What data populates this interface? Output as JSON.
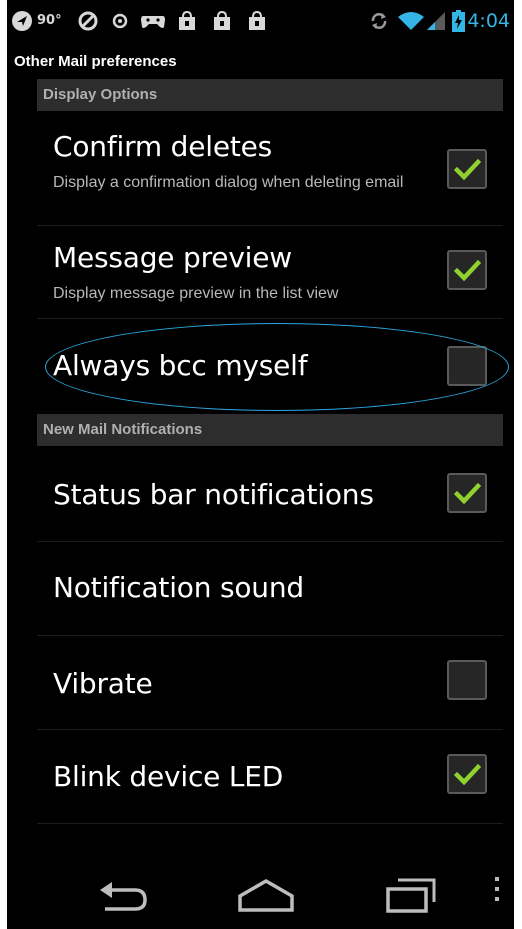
{
  "status_bar": {
    "temperature": "90°",
    "time": "4:04",
    "icons": [
      "nav-arrow-icon",
      "blocked-icon",
      "circle-dot-icon",
      "game-controller-icon",
      "shopping-bag-icon",
      "shopping-bag-icon",
      "shopping-bag-icon",
      "sync-icon",
      "wifi-icon",
      "cell-signal-icon",
      "battery-icon"
    ],
    "accent_color": "#33b5e5"
  },
  "app": {
    "title": "Other Mail preferences"
  },
  "sections": [
    {
      "header": "Display Options",
      "items": [
        {
          "title": "Confirm deletes",
          "summary": "Display a confirmation dialog when deleting email",
          "has_checkbox": true,
          "checked": true
        },
        {
          "title": "Message preview",
          "summary": "Display message preview in the list view",
          "has_checkbox": true,
          "checked": true
        },
        {
          "title": "Always bcc myself",
          "summary": "",
          "has_checkbox": true,
          "checked": false
        }
      ]
    },
    {
      "header": "New Mail Notifications",
      "items": [
        {
          "title": "Status bar notifications",
          "summary": "",
          "has_checkbox": true,
          "checked": true
        },
        {
          "title": "Notification sound",
          "summary": "",
          "has_checkbox": false,
          "checked": false
        },
        {
          "title": "Vibrate",
          "summary": "",
          "has_checkbox": true,
          "checked": false
        },
        {
          "title": "Blink device LED",
          "summary": "",
          "has_checkbox": true,
          "checked": true
        }
      ]
    }
  ],
  "nav": {
    "buttons": [
      "back-icon",
      "home-icon",
      "recent-apps-icon",
      "overflow-menu-icon"
    ]
  },
  "colors": {
    "check_green": "#8fd12f",
    "highlight": "#2aa7e0",
    "section_bg": "#2d2d2d"
  }
}
